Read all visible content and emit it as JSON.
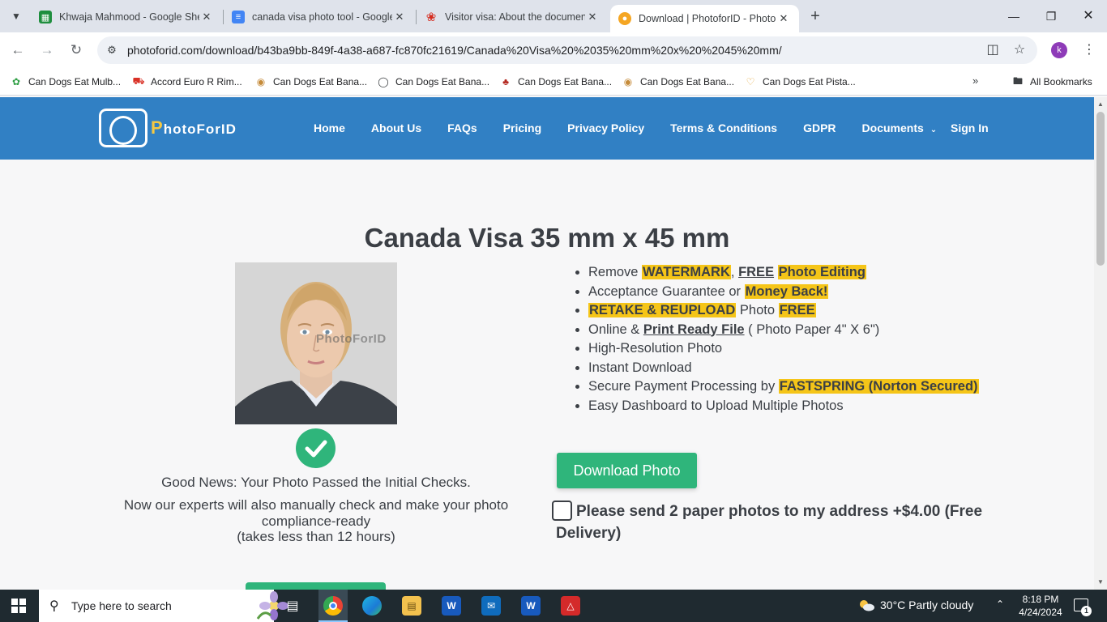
{
  "browser": {
    "tabs": [
      {
        "title": "Khwaja Mahmood - Google Sheets",
        "icon": "sheets-icon",
        "color": "#1e8e3e"
      },
      {
        "title": "canada visa photo tool - Google Docs",
        "icon": "docs-icon",
        "color": "#4285f4"
      },
      {
        "title": "Visitor visa: About the documents",
        "icon": "maple-leaf-icon",
        "color": "#d52b1e"
      },
      {
        "title": "Download | PhotoforID - Photo",
        "icon": "photoforid-icon",
        "color": "#f5a623"
      }
    ],
    "url": "photoforid.com/download/b43ba9bb-849f-4a38-a687-fc870fc21619/Canada%20Visa%20%2035%20mm%20x%20%2045%20mm/",
    "profile_initial": "k",
    "bookmarks": [
      {
        "label": "Can Dogs Eat Mulb...",
        "icon": "leaf-icon"
      },
      {
        "label": "Accord Euro R Rim...",
        "icon": "car-icon"
      },
      {
        "label": "Can Dogs Eat Bana...",
        "icon": "dog-icon"
      },
      {
        "label": "Can Dogs Eat Bana...",
        "icon": "globe-icon"
      },
      {
        "label": "Can Dogs Eat Bana...",
        "icon": "paw-icon"
      },
      {
        "label": "Can Dogs Eat Bana...",
        "icon": "dog-icon"
      },
      {
        "label": "Can Dogs Eat Pista...",
        "icon": "heart-icon"
      }
    ],
    "all_bookmarks": "All Bookmarks"
  },
  "site": {
    "logo_text_p": "P",
    "logo_text_rest": "hotoForID",
    "nav": [
      "Home",
      "About Us",
      "FAQs",
      "Pricing",
      "Privacy Policy",
      "Terms & Conditions",
      "GDPR",
      "Documents"
    ],
    "sign_in": "Sign In",
    "accent": "#3180c4",
    "green": "#2fb57b",
    "highlight": "#f5c518"
  },
  "main": {
    "title": "Canada Visa 35 mm x 45 mm",
    "watermark": "PhotoForID",
    "good_news": "Good News: Your Photo Passed the Initial Checks.",
    "experts_line1": "Now our experts will also manually check and make your photo compliance-ready",
    "experts_line2": "(takes less than 12 hours)",
    "features": {
      "f1_a": "Remove ",
      "f1_b": "WATERMARK",
      "f1_c": ", ",
      "f1_d": "FREE",
      "f1_e": " ",
      "f1_f": "Photo Editing ",
      "f2_a": "Acceptance Guarantee or ",
      "f2_b": "Money Back!",
      "f3_a": "RETAKE & REUPLOAD",
      "f3_b": " Photo ",
      "f3_c": "FREE",
      "f4_a": "Online & ",
      "f4_b": "Print Ready File",
      "f4_c": " ( Photo Paper 4\" X 6\")",
      "f5": "High-Resolution Photo",
      "f6": "Instant Download",
      "f7_a": "Secure Payment Processing by ",
      "f7_b": "FASTSPRING (Norton Secured)",
      "f8": "Easy Dashboard to Upload Multiple Photos"
    },
    "download_button": "Download Photo",
    "paper_option_line1": "Please send 2 paper photos to my address +$4.00 (Free",
    "paper_option_line2": "Delivery)"
  },
  "taskbar": {
    "search_placeholder": "Type here to search",
    "weather": "30°C  Partly cloudy",
    "time": "8:18 PM",
    "date": "4/24/2024",
    "notification_count": "1"
  }
}
